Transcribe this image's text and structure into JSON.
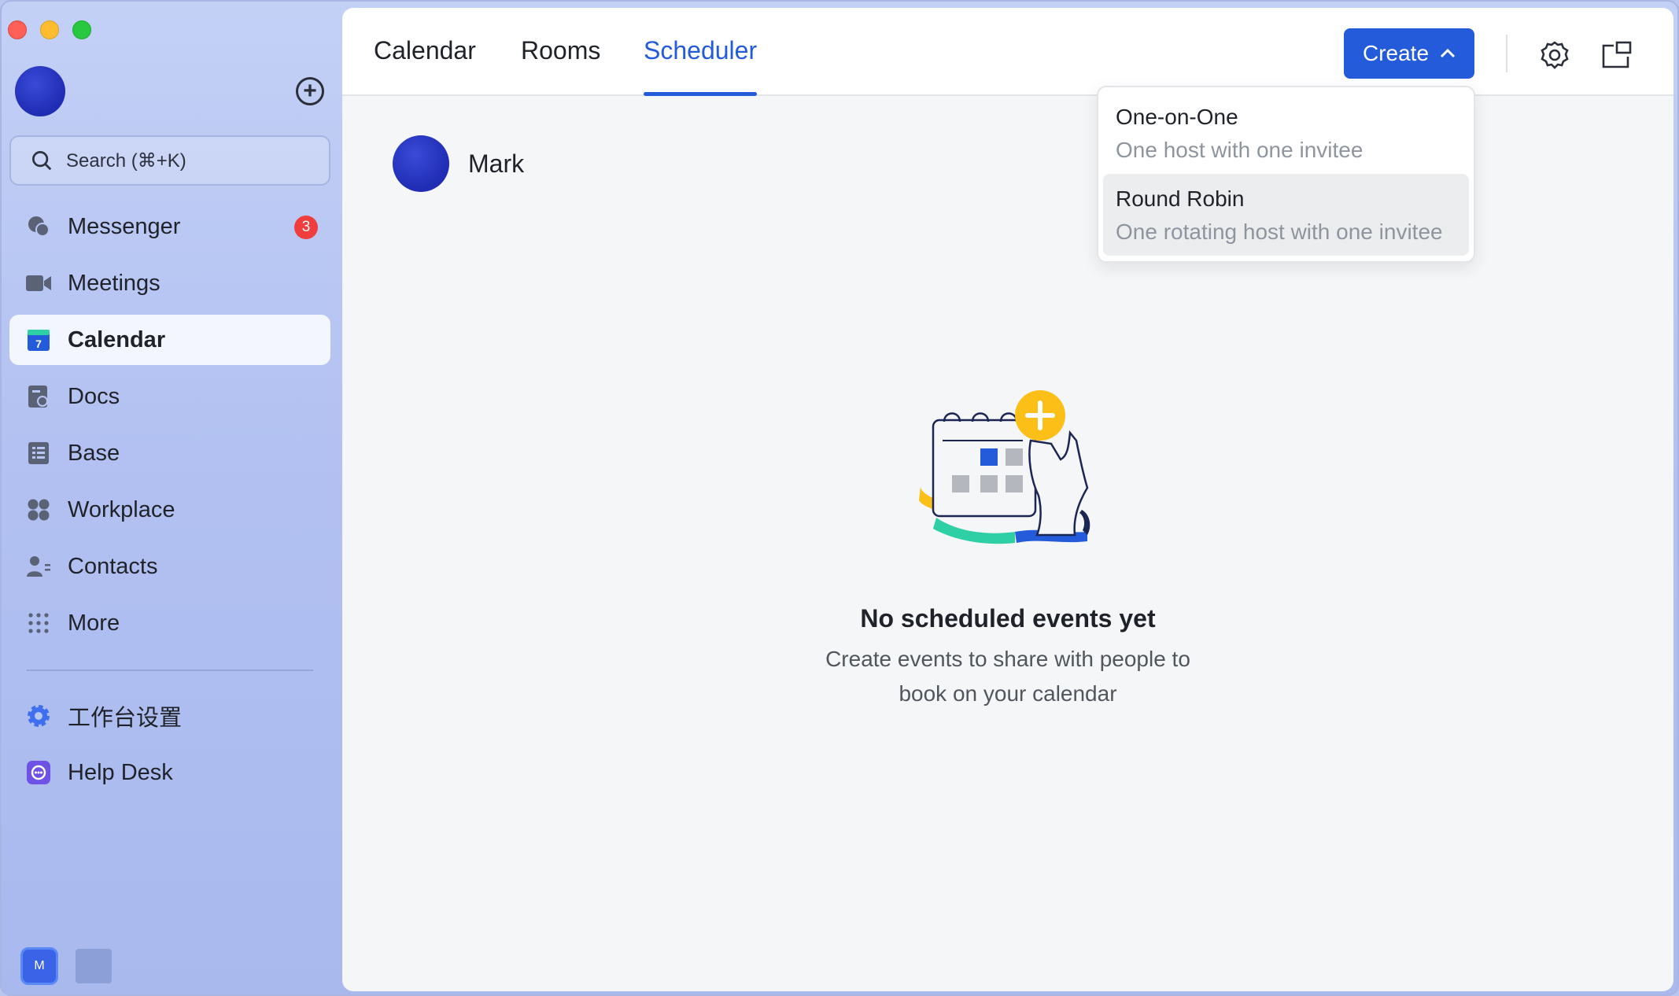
{
  "sidebar": {
    "search_placeholder": "Search (⌘+K)",
    "items": [
      {
        "name": "messenger",
        "label": "Messenger",
        "icon": "chat-bubbles-icon",
        "badge": "3"
      },
      {
        "name": "meetings",
        "label": "Meetings",
        "icon": "video-camera-icon"
      },
      {
        "name": "calendar",
        "label": "Calendar",
        "icon": "calendar-icon",
        "calendar_day": "7",
        "active": true
      },
      {
        "name": "docs",
        "label": "Docs",
        "icon": "docs-icon"
      },
      {
        "name": "base",
        "label": "Base",
        "icon": "base-table-icon"
      },
      {
        "name": "workplace",
        "label": "Workplace",
        "icon": "workplace-grid-icon"
      },
      {
        "name": "contacts",
        "label": "Contacts",
        "icon": "contacts-icon"
      },
      {
        "name": "more",
        "label": "More",
        "icon": "dots-grid-icon"
      }
    ],
    "secondary_items": [
      {
        "name": "workspace-settings",
        "label": "工作台设置",
        "icon": "gear-filled-icon"
      },
      {
        "name": "help-desk",
        "label": "Help Desk",
        "icon": "help-desk-icon"
      }
    ],
    "bottom_tile_label": "M"
  },
  "topbar": {
    "tabs": [
      {
        "label": "Calendar"
      },
      {
        "label": "Rooms"
      },
      {
        "label": "Scheduler",
        "active": true
      }
    ],
    "create_label": "Create"
  },
  "user": {
    "name": "Mark"
  },
  "dropdown": {
    "items": [
      {
        "title": "One-on-One",
        "subtitle": "One host with one invitee"
      },
      {
        "title": "Round Robin",
        "subtitle": "One rotating host with one invitee",
        "highlighted": true
      }
    ]
  },
  "empty_state": {
    "title": "No scheduled events yet",
    "description": "Create events to share with people to book on your calendar"
  },
  "colors": {
    "accent": "#245bdb",
    "badge": "#f03e3e",
    "illustration_yellow": "#fbbf17",
    "illustration_teal": "#2ecfa4"
  }
}
